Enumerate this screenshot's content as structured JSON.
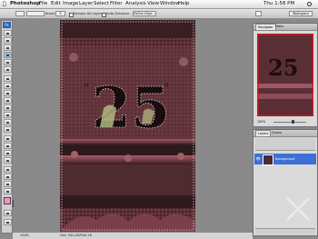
{
  "menubar": {
    "app": "Photoshop",
    "items": [
      "File",
      "Edit",
      "Image",
      "Layer",
      "Select",
      "Filter",
      "Analysis",
      "View",
      "Window",
      "Help"
    ],
    "clock": "Thu 1:58 PM"
  },
  "options": {
    "brush_label": "Brush:",
    "brush_size": "5",
    "sample_all_layers": "Sample All Layers",
    "auto_enhance": "Auto-Enhance",
    "refine_edge": "Refine Edge..."
  },
  "workspace": {
    "label": "Workspace"
  },
  "status": {
    "zoom": "100%",
    "doc": "Doc: 944.2K/944.2K"
  },
  "navigator": {
    "tabs": [
      "Navigator",
      "Histo"
    ],
    "zoom": "100%"
  },
  "layers": {
    "tabs": [
      "Layers",
      "Chann"
    ],
    "layer_name": "Background"
  },
  "colors": {
    "foreground": "#ff8fc8",
    "background": "#ffffff",
    "selection_accent": "#3d6fd6"
  }
}
